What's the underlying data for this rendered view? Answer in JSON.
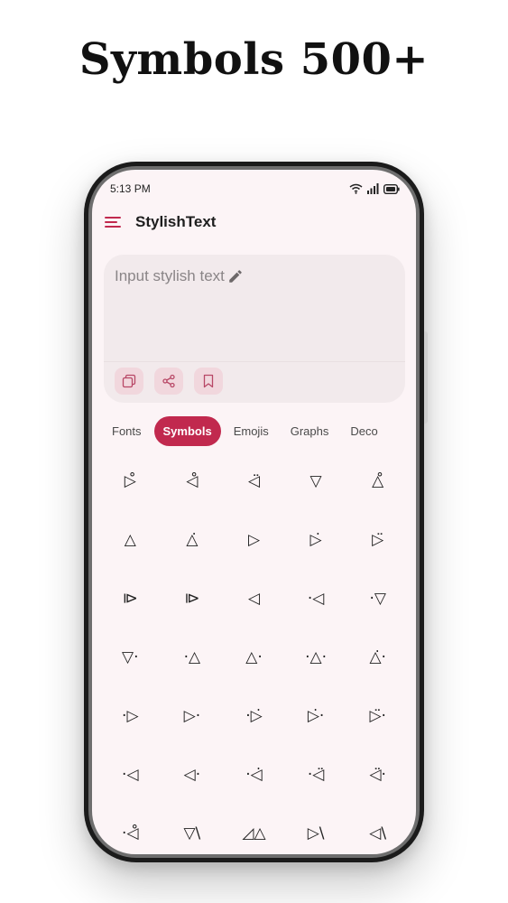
{
  "promo": {
    "title": "Symbols 500+"
  },
  "status_bar": {
    "time": "5:13 PM",
    "icons": [
      "wifi-icon",
      "signal-icon",
      "battery-icon"
    ]
  },
  "app_bar": {
    "menu_icon": "hamburger-menu-icon",
    "title": "StylishText"
  },
  "input": {
    "placeholder": "Input stylish text",
    "edit_icon": "pencil-icon",
    "actions": [
      {
        "name": "copy-button",
        "icon": "copy-icon"
      },
      {
        "name": "share-button",
        "icon": "share-icon"
      },
      {
        "name": "bookmark-button",
        "icon": "bookmark-icon"
      }
    ]
  },
  "tabs": [
    {
      "label": "Fonts",
      "active": false
    },
    {
      "label": "Symbols",
      "active": true
    },
    {
      "label": "Emojis",
      "active": false
    },
    {
      "label": "Graphs",
      "active": false
    },
    {
      "label": "Deco",
      "active": false
    }
  ],
  "symbols": [
    "▷̊",
    "◁̊",
    "◁̈",
    "▽",
    "△̊",
    "△",
    "△̇",
    "▷",
    "▷̇",
    "▷̈",
    "⧐",
    "⧐",
    "◁",
    "·◁",
    "·▽",
    "▽·",
    "·△",
    "△·",
    "·△·",
    "△̇·",
    "·▷",
    "▷·",
    "·▷̇",
    "▷̇·",
    "▷̈·",
    "·◁",
    "◁·",
    "·◁̇",
    "·◁̈",
    "◁̈·",
    "·◁̊",
    "▽\\",
    "◿△",
    "▷\\",
    "◁\\"
  ]
}
